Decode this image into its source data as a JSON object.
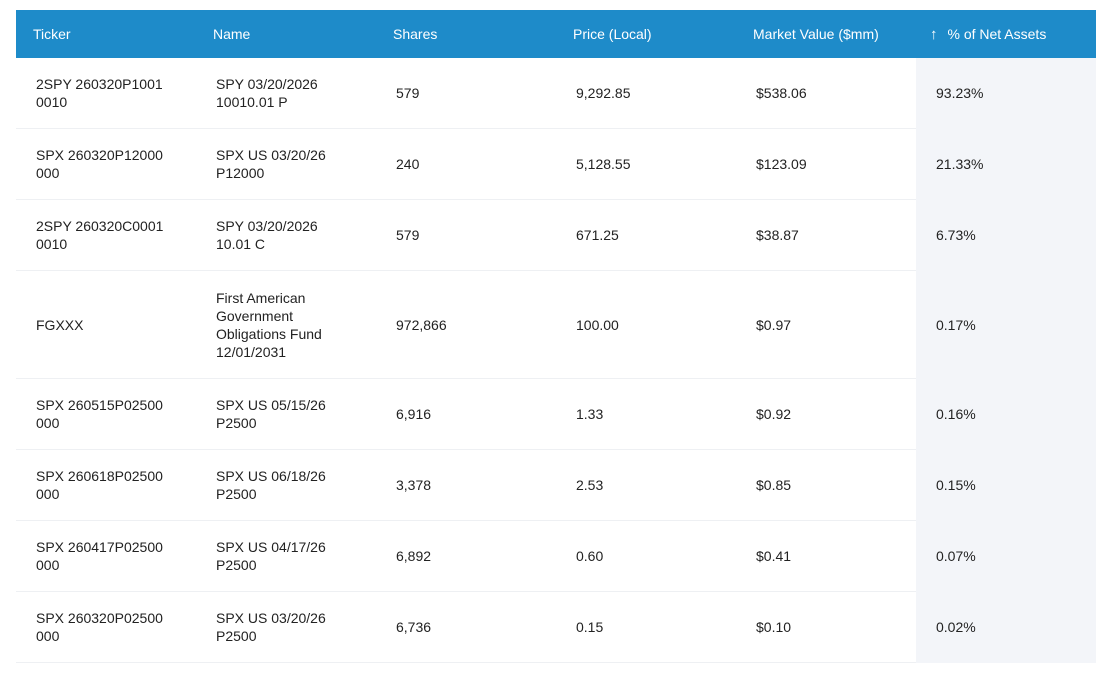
{
  "table": {
    "columns": [
      "Ticker",
      "Name",
      "Shares",
      "Price (Local)",
      "Market Value ($mm)",
      "% of Net Assets"
    ],
    "sort_arrow": "↑",
    "rows": [
      {
        "ticker": "2SPY 260320P10010010",
        "name": "SPY 03/20/2026 10010.01 P",
        "shares": "579",
        "price": "9,292.85",
        "market_value": "$538.06",
        "pct": "93.23%"
      },
      {
        "ticker": "SPX 260320P12000000",
        "name": "SPX US 03/20/26 P12000",
        "shares": "240",
        "price": "5,128.55",
        "market_value": "$123.09",
        "pct": "21.33%"
      },
      {
        "ticker": "2SPY 260320C00010010",
        "name": "SPY 03/20/2026 10.01 C",
        "shares": "579",
        "price": "671.25",
        "market_value": "$38.87",
        "pct": "6.73%"
      },
      {
        "ticker": "FGXXX",
        "name": "First American Government Obligations Fund 12/01/2031",
        "shares": "972,866",
        "price": "100.00",
        "market_value": "$0.97",
        "pct": "0.17%"
      },
      {
        "ticker": "SPX 260515P02500000",
        "name": "SPX US 05/15/26 P2500",
        "shares": "6,916",
        "price": "1.33",
        "market_value": "$0.92",
        "pct": "0.16%"
      },
      {
        "ticker": "SPX 260618P02500000",
        "name": "SPX US 06/18/26 P2500",
        "shares": "3,378",
        "price": "2.53",
        "market_value": "$0.85",
        "pct": "0.15%"
      },
      {
        "ticker": "SPX 260417P02500000",
        "name": "SPX US 04/17/26 P2500",
        "shares": "6,892",
        "price": "0.60",
        "market_value": "$0.41",
        "pct": "0.07%"
      },
      {
        "ticker": "SPX 260320P02500000",
        "name": "SPX US 03/20/26 P2500",
        "shares": "6,736",
        "price": "0.15",
        "market_value": "$0.10",
        "pct": "0.02%"
      }
    ]
  },
  "colors": {
    "header_bg": "#1e8bc9",
    "header_text": "#ffffff",
    "sorted_column_bg": "#f3f5f9",
    "row_divider": "#eef0f3"
  },
  "icons": {
    "sort": "arrow-up-icon"
  }
}
